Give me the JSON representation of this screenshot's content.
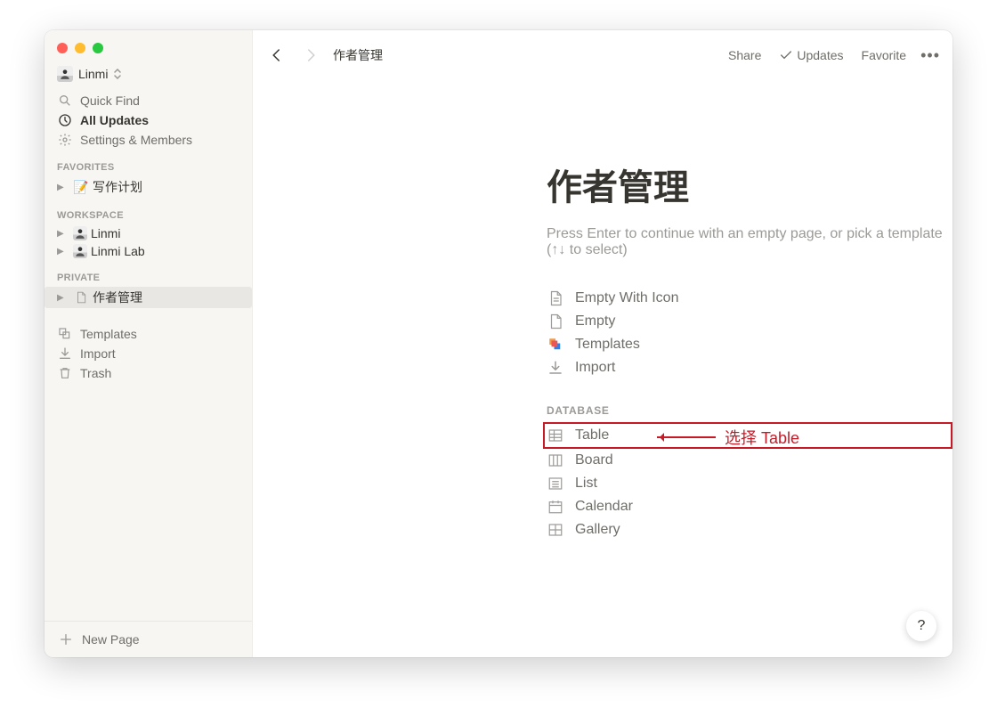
{
  "window": {
    "workspace_name": "Linmi"
  },
  "sidebar": {
    "quick_find": "Quick Find",
    "all_updates": "All Updates",
    "settings": "Settings & Members",
    "sections": {
      "favorites_label": "FAVORITES",
      "workspace_label": "WORKSPACE",
      "private_label": "PRIVATE"
    },
    "favorites": [
      {
        "emoji": "📝",
        "label": "写作计划"
      }
    ],
    "workspace": [
      {
        "type": "avatar",
        "label": "Linmi"
      },
      {
        "type": "avatar",
        "label": "Linmi Lab"
      }
    ],
    "private": [
      {
        "type": "page",
        "label": "作者管理",
        "selected": true
      }
    ],
    "templates": "Templates",
    "import": "Import",
    "trash": "Trash",
    "new_page": "New Page"
  },
  "topbar": {
    "breadcrumb": "作者管理",
    "share": "Share",
    "updates": "Updates",
    "favorite": "Favorite"
  },
  "page": {
    "title": "作者管理",
    "placeholder": "Press Enter to continue with an empty page, or pick a template (↑↓ to select)",
    "options": [
      {
        "id": "empty-with-icon",
        "label": "Empty With Icon",
        "icon": "doc-lines"
      },
      {
        "id": "empty",
        "label": "Empty",
        "icon": "doc"
      },
      {
        "id": "templates",
        "label": "Templates",
        "icon": "templates-color"
      },
      {
        "id": "import",
        "label": "Import",
        "icon": "download"
      }
    ],
    "database_label": "DATABASE",
    "database_options": [
      {
        "id": "table",
        "label": "Table",
        "icon": "table",
        "highlight": true
      },
      {
        "id": "board",
        "label": "Board",
        "icon": "board"
      },
      {
        "id": "list",
        "label": "List",
        "icon": "list"
      },
      {
        "id": "calendar",
        "label": "Calendar",
        "icon": "calendar"
      },
      {
        "id": "gallery",
        "label": "Gallery",
        "icon": "gallery"
      }
    ]
  },
  "annotation": {
    "text": "选择 Table"
  },
  "help": "?"
}
